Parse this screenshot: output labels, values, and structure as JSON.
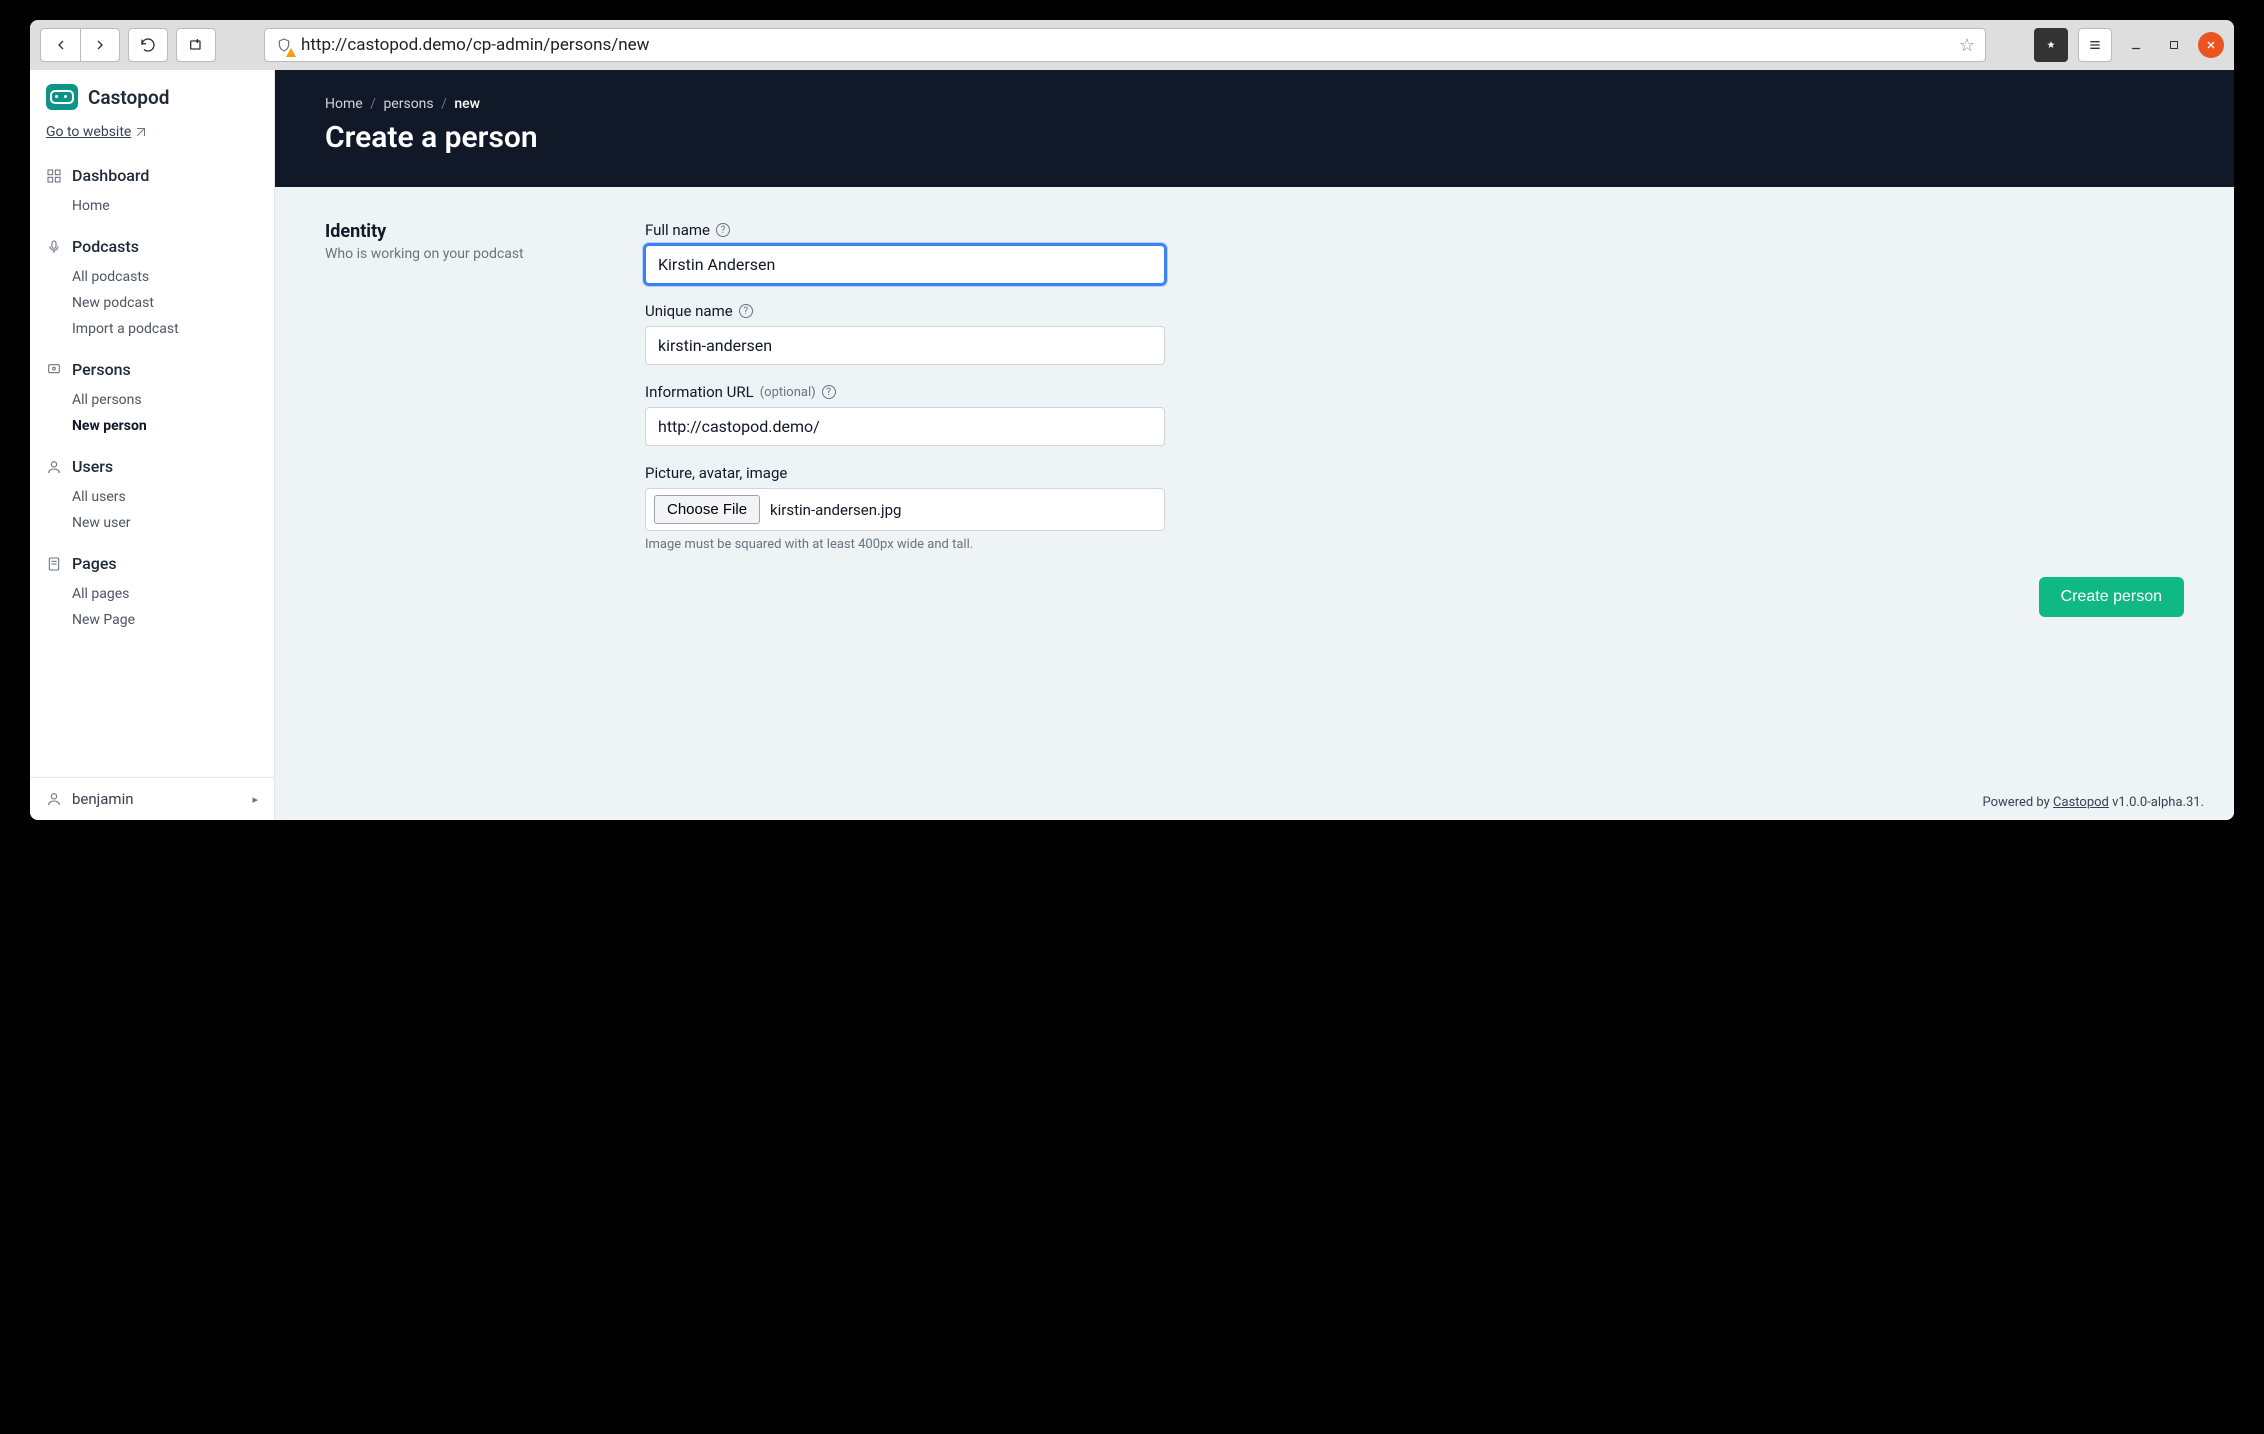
{
  "browser": {
    "url": "http://castopod.demo/cp-admin/persons/new"
  },
  "app": {
    "brand": "Castopod",
    "go_to_website": "Go to website"
  },
  "sidebar": {
    "sections": [
      {
        "label": "Dashboard",
        "items": [
          {
            "label": "Home",
            "active": false
          }
        ]
      },
      {
        "label": "Podcasts",
        "items": [
          {
            "label": "All podcasts",
            "active": false
          },
          {
            "label": "New podcast",
            "active": false
          },
          {
            "label": "Import a podcast",
            "active": false
          }
        ]
      },
      {
        "label": "Persons",
        "items": [
          {
            "label": "All persons",
            "active": false
          },
          {
            "label": "New person",
            "active": true
          }
        ]
      },
      {
        "label": "Users",
        "items": [
          {
            "label": "All users",
            "active": false
          },
          {
            "label": "New user",
            "active": false
          }
        ]
      },
      {
        "label": "Pages",
        "items": [
          {
            "label": "All pages",
            "active": false
          },
          {
            "label": "New Page",
            "active": false
          }
        ]
      }
    ],
    "user": "benjamin"
  },
  "header": {
    "breadcrumb": {
      "home": "Home",
      "parent": "persons",
      "current": "new"
    },
    "title": "Create a person"
  },
  "form": {
    "section_title": "Identity",
    "section_subtitle": "Who is working on your podcast",
    "fields": {
      "full_name": {
        "label": "Full name",
        "value": "Kirstin Andersen"
      },
      "unique_name": {
        "label": "Unique name",
        "value": "kirstin-andersen"
      },
      "info_url": {
        "label": "Information URL",
        "optional": "(optional)",
        "value": "http://castopod.demo/"
      },
      "picture": {
        "label": "Picture, avatar, image",
        "choose_label": "Choose File",
        "file_name": "kirstin-andersen.jpg",
        "hint": "Image must be squared with at least 400px wide and tall."
      }
    },
    "submit_label": "Create person"
  },
  "footer": {
    "powered_by": "Powered by ",
    "product": "Castopod",
    "version": " v1.0.0-alpha.31."
  }
}
